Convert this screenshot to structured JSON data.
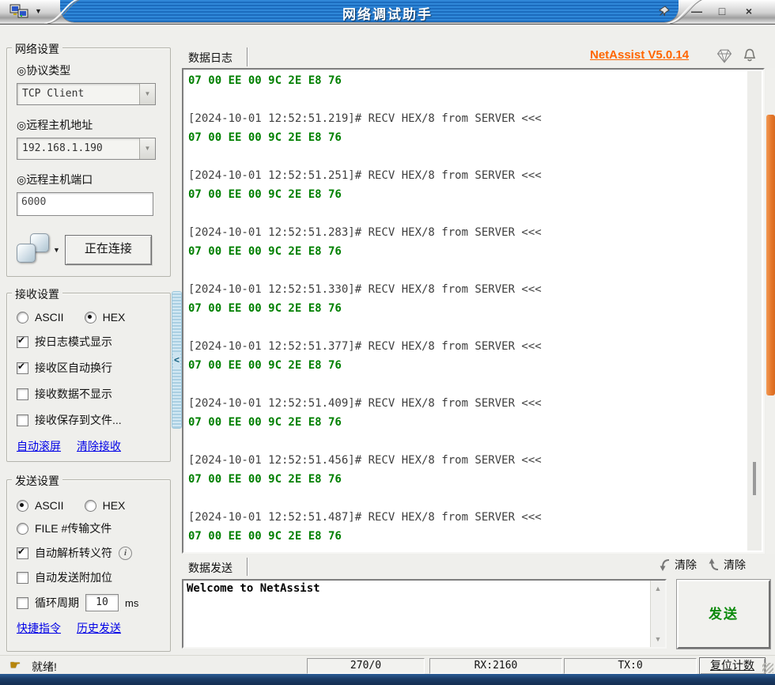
{
  "window": {
    "title": "网络调试助手",
    "controls": {
      "minimize": "—",
      "maximize": "□",
      "close": "×"
    }
  },
  "header": {
    "log_tab": "数据日志",
    "version_link": "NetAssist V5.0.14"
  },
  "colors": {
    "titlebar_blue": "#1e78c8",
    "accent_orange": "#ff6600",
    "hex_green": "#008000",
    "link_blue": "#0000e6",
    "scrollbar_orange": "#e4762a"
  },
  "network_settings": {
    "title": "网络设置",
    "protocol_label": "◎协议类型",
    "protocol_value": "TCP Client",
    "host_label": "◎远程主机地址",
    "host_value": "192.168.1.190",
    "port_label": "◎远程主机端口",
    "port_value": "6000",
    "connect_button": "正在连接",
    "dropdown_glyph": "▼"
  },
  "receive_settings": {
    "title": "接收设置",
    "options": [
      {
        "label": "ASCII",
        "selected": false
      },
      {
        "label": "HEX",
        "selected": true
      }
    ],
    "checkboxes": [
      {
        "label": "按日志模式显示",
        "checked": true
      },
      {
        "label": "接收区自动换行",
        "checked": true
      },
      {
        "label": "接收数据不显示",
        "checked": false
      },
      {
        "label": "接收保存到文件...",
        "checked": false
      }
    ],
    "links": [
      "自动滚屏",
      "清除接收"
    ]
  },
  "send_settings": {
    "title": "发送设置",
    "options": [
      {
        "label": "ASCII",
        "selected": true
      },
      {
        "label": "HEX",
        "selected": false
      }
    ],
    "file_option": {
      "label": "FILE #传输文件",
      "selected": false
    },
    "checkboxes": [
      {
        "label": "自动解析转义符",
        "checked": true
      },
      {
        "label": "自动发送附加位",
        "checked": false
      },
      {
        "label": "循环周期",
        "checked": false
      }
    ],
    "cycle_value": "10",
    "cycle_unit": "ms",
    "links": [
      "快捷指令",
      "历史发送"
    ]
  },
  "log": {
    "hex_line": "07 00 EE 00 9C 2E E8 76",
    "timestamps": [
      "[2024-10-01 12:52:51.219]# RECV HEX/8 from SERVER <<<",
      "[2024-10-01 12:52:51.251]# RECV HEX/8 from SERVER <<<",
      "[2024-10-01 12:52:51.283]# RECV HEX/8 from SERVER <<<",
      "[2024-10-01 12:52:51.330]# RECV HEX/8 from SERVER <<<",
      "[2024-10-01 12:52:51.377]# RECV HEX/8 from SERVER <<<",
      "[2024-10-01 12:52:51.409]# RECV HEX/8 from SERVER <<<",
      "[2024-10-01 12:52:51.456]# RECV HEX/8 from SERVER <<<",
      "[2024-10-01 12:52:51.487]# RECV HEX/8 from SERVER <<<"
    ]
  },
  "send_area": {
    "tab": "数据发送",
    "clear_recv_label": "清除",
    "clear_send_label": "清除",
    "input_text": "Welcome to NetAssist",
    "send_button": "发送"
  },
  "status_bar": {
    "status": "就绪!",
    "packets": "270/0",
    "rx": "RX:2160",
    "tx": "TX:0",
    "reset_button": "复位计数"
  }
}
